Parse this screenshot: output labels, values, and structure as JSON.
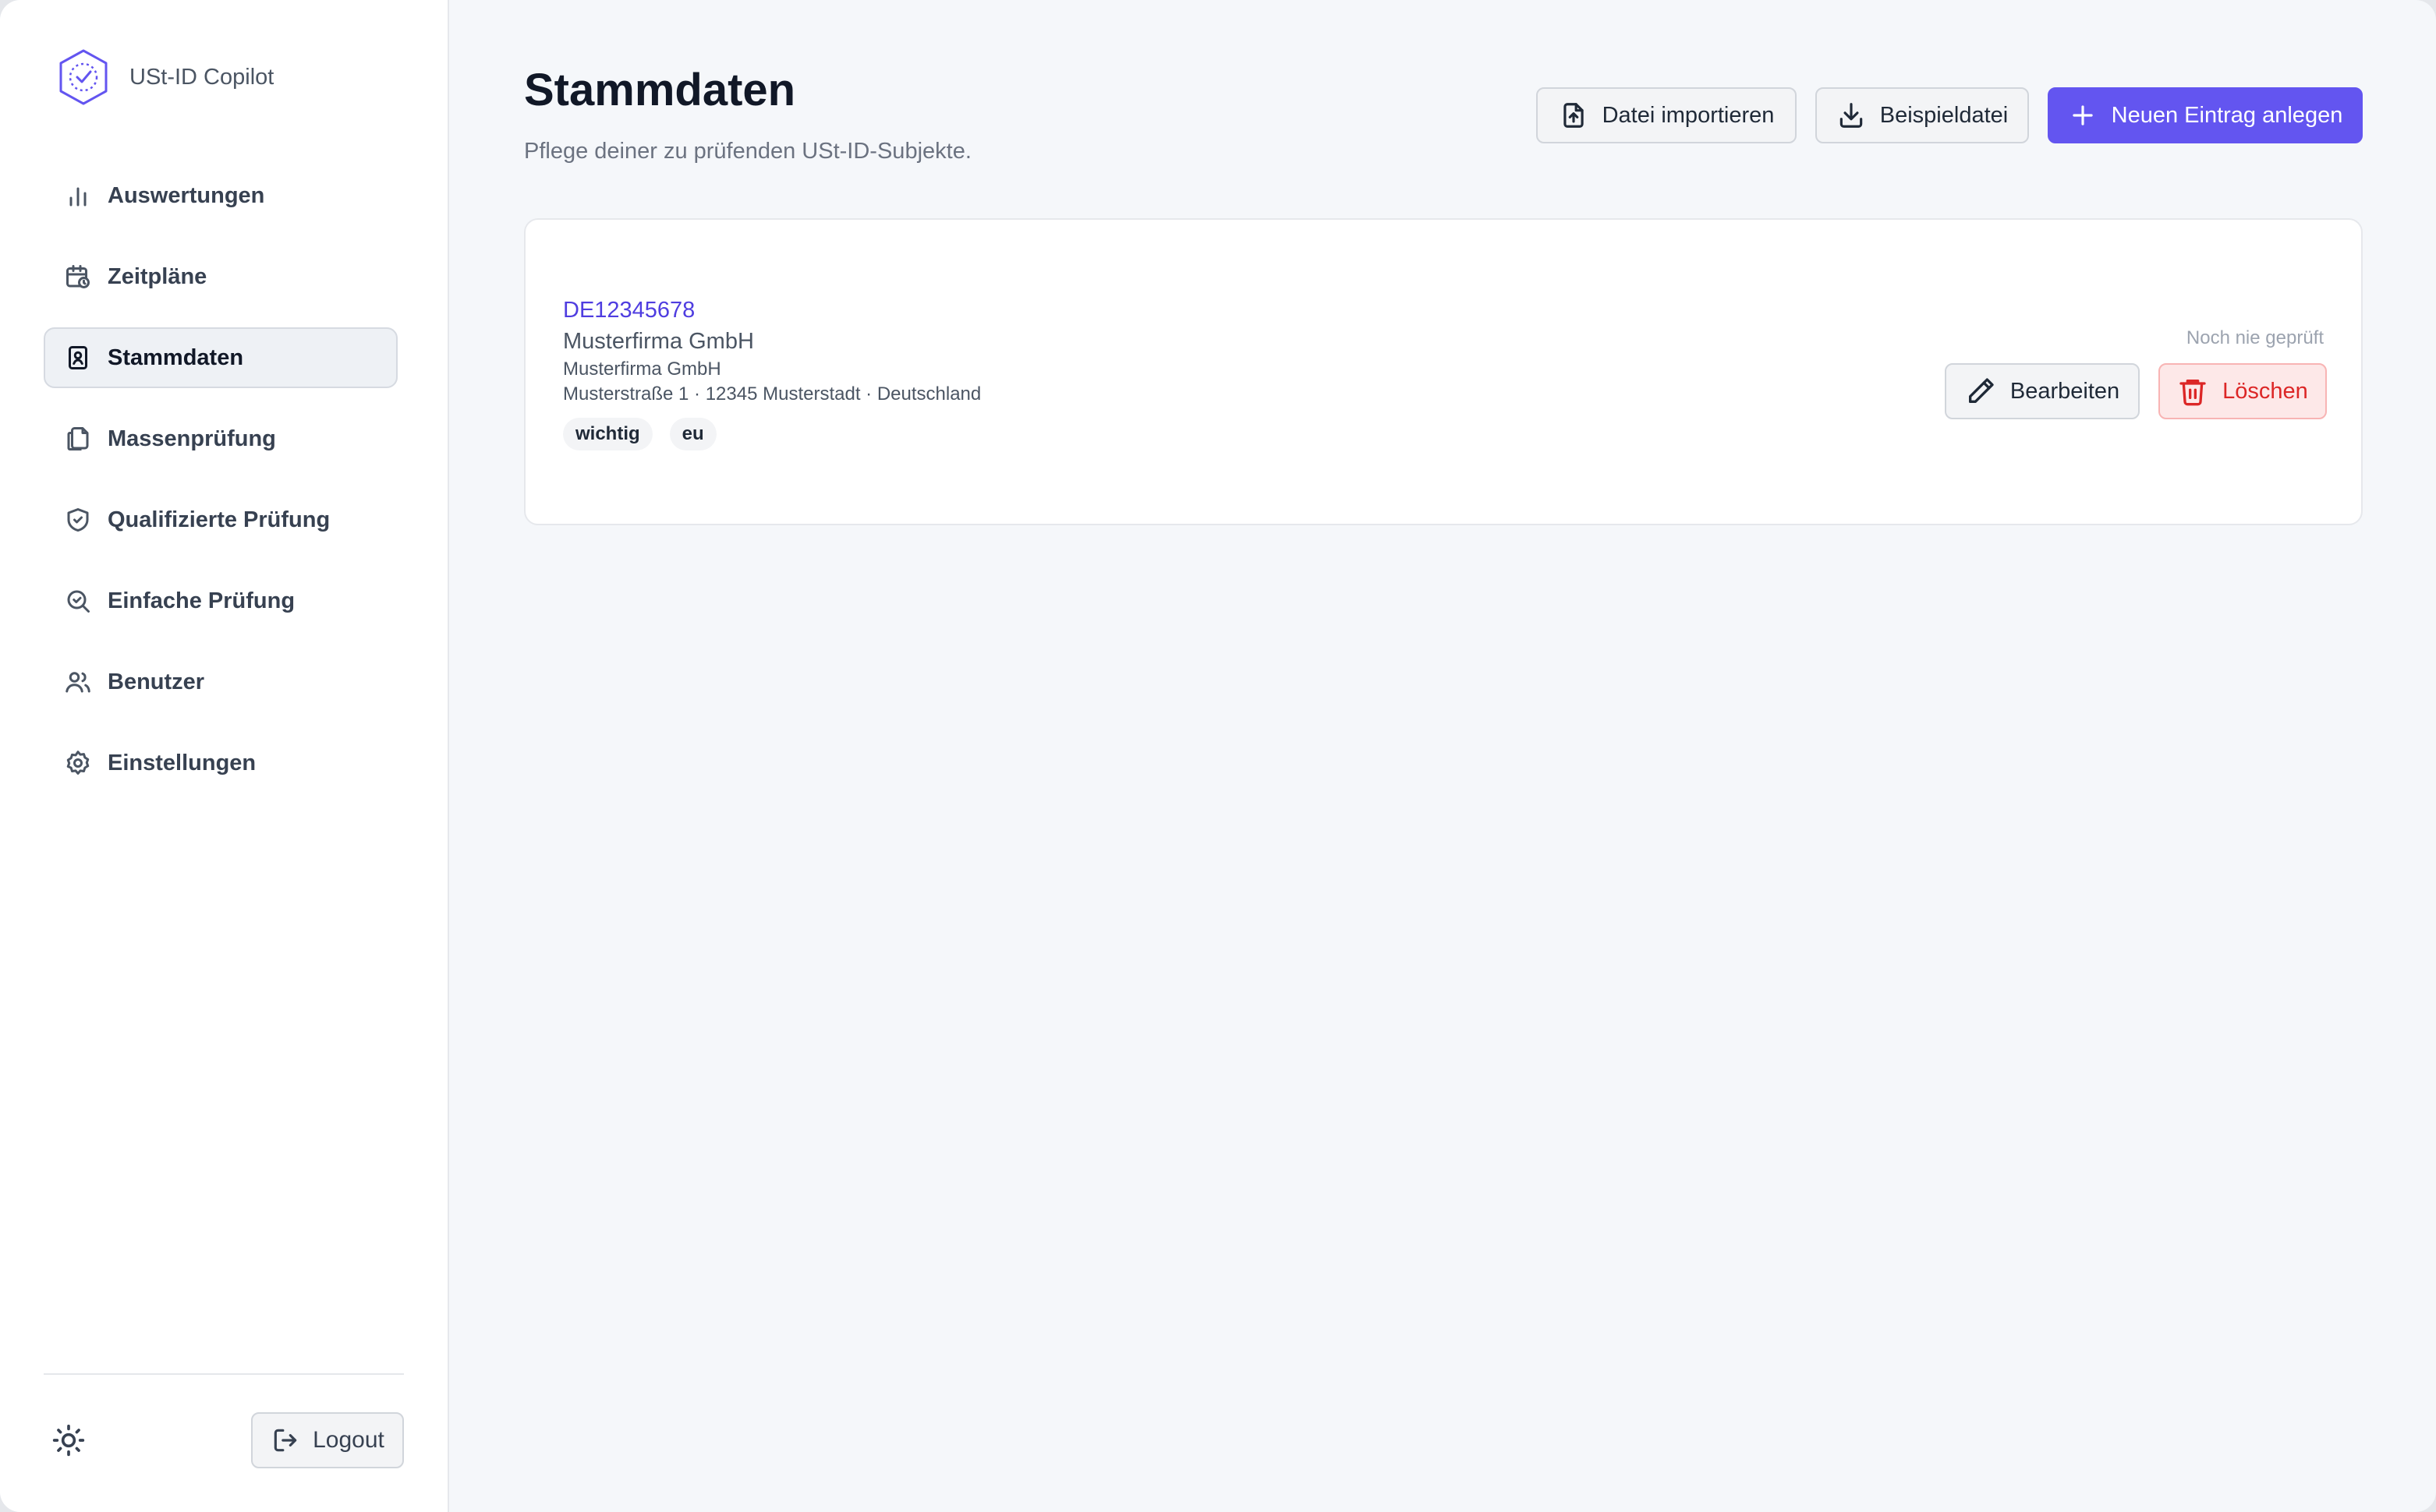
{
  "app": {
    "name": "USt-ID Copilot"
  },
  "sidebar": {
    "items": [
      {
        "label": "Auswertungen",
        "icon": "bar-chart-icon",
        "active": false
      },
      {
        "label": "Zeitpläne",
        "icon": "calendar-clock-icon",
        "active": false
      },
      {
        "label": "Stammdaten",
        "icon": "contact-book-icon",
        "active": true
      },
      {
        "label": "Massenprüfung",
        "icon": "copy-files-icon",
        "active": false
      },
      {
        "label": "Qualifizierte Prüfung",
        "icon": "shield-check-icon",
        "active": false
      },
      {
        "label": "Einfache Prüfung",
        "icon": "search-check-icon",
        "active": false
      },
      {
        "label": "Benutzer",
        "icon": "users-icon",
        "active": false
      },
      {
        "label": "Einstellungen",
        "icon": "gear-icon",
        "active": false
      }
    ],
    "theme_icon": "sun-icon",
    "logout_label": "Logout"
  },
  "header": {
    "title": "Stammdaten",
    "subtitle": "Pflege deiner zu prüfenden USt-ID-Subjekte.",
    "import_label": "Datei importieren",
    "example_label": "Beispieldatei",
    "new_label": "Neuen Eintrag anlegen"
  },
  "entries": [
    {
      "vat_id": "DE12345678",
      "name": "Musterfirma GmbH",
      "name_secondary": "Musterfirma GmbH",
      "address": "Musterstraße 1 · 12345 Musterstadt · Deutschland",
      "tags": [
        "wichtig",
        "eu"
      ],
      "status": "Noch nie geprüft",
      "edit_label": "Bearbeiten",
      "delete_label": "Löschen"
    }
  ],
  "colors": {
    "accent": "#6355f0",
    "link": "#4f3de0",
    "danger": "#dc2626",
    "danger_bg": "#fde8e8"
  }
}
